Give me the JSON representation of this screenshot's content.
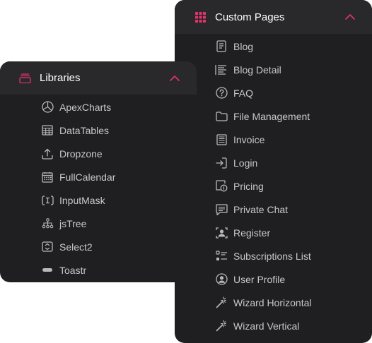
{
  "colors": {
    "accent": "#e2336b",
    "panel_bg": "#1f1f21",
    "header_bg": "#29292c",
    "text": "#c8c8cc",
    "title": "#ffffff"
  },
  "custom_pages": {
    "title": "Custom Pages",
    "header_icon": "grid-icon",
    "items": [
      {
        "label": "Blog",
        "icon": "document-icon"
      },
      {
        "label": "Blog Detail",
        "icon": "text-lines-icon"
      },
      {
        "label": "FAQ",
        "icon": "question-circle-icon"
      },
      {
        "label": "File Management",
        "icon": "folder-icon"
      },
      {
        "label": "Invoice",
        "icon": "invoice-icon"
      },
      {
        "label": "Login",
        "icon": "login-icon"
      },
      {
        "label": "Pricing",
        "icon": "pricing-icon"
      },
      {
        "label": "Private Chat",
        "icon": "chat-icon"
      },
      {
        "label": "Register",
        "icon": "register-icon"
      },
      {
        "label": "Subscriptions List",
        "icon": "checklist-icon"
      },
      {
        "label": "User Profile",
        "icon": "user-circle-icon"
      },
      {
        "label": "Wizard Horizontal",
        "icon": "magic-wand-icon"
      },
      {
        "label": "Wizard Vertical",
        "icon": "magic-wand-icon"
      }
    ]
  },
  "libraries": {
    "title": "Libraries",
    "header_icon": "box-icon",
    "items": [
      {
        "label": "ApexCharts",
        "icon": "pie-chart-icon"
      },
      {
        "label": "DataTables",
        "icon": "table-icon"
      },
      {
        "label": "Dropzone",
        "icon": "upload-icon"
      },
      {
        "label": "FullCalendar",
        "icon": "calendar-icon"
      },
      {
        "label": "InputMask",
        "icon": "input-mask-icon"
      },
      {
        "label": "jsTree",
        "icon": "tree-icon"
      },
      {
        "label": "Select2",
        "icon": "select-icon"
      },
      {
        "label": "Toastr",
        "icon": "toast-icon"
      }
    ]
  }
}
